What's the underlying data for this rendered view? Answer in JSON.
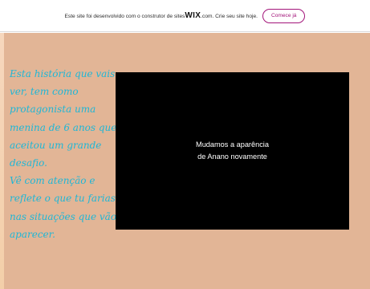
{
  "banner": {
    "prefix": "Este site foi desenvolvido com o construtor de sites ",
    "brand": "WIX",
    "suffix": ".com. Crie seu site hoje.",
    "button_label": "Comece já"
  },
  "story": {
    "lines": [
      "Esta história que vais",
      "ver, tem como",
      "protagonista uma",
      "menina de 6 anos que",
      "aceitou um grande",
      "desafio.",
      "Vê com atenção e",
      "reflete o que tu farias",
      "nas situações que vão",
      "aparecer."
    ]
  },
  "video": {
    "line1": "Mudamos a aparência",
    "line2": "de Anano novamente"
  },
  "colors": {
    "page_background": "#e2b596",
    "story_text": "#1fb6d6",
    "wix_button_accent": "#a3157a",
    "video_background": "#000000"
  }
}
